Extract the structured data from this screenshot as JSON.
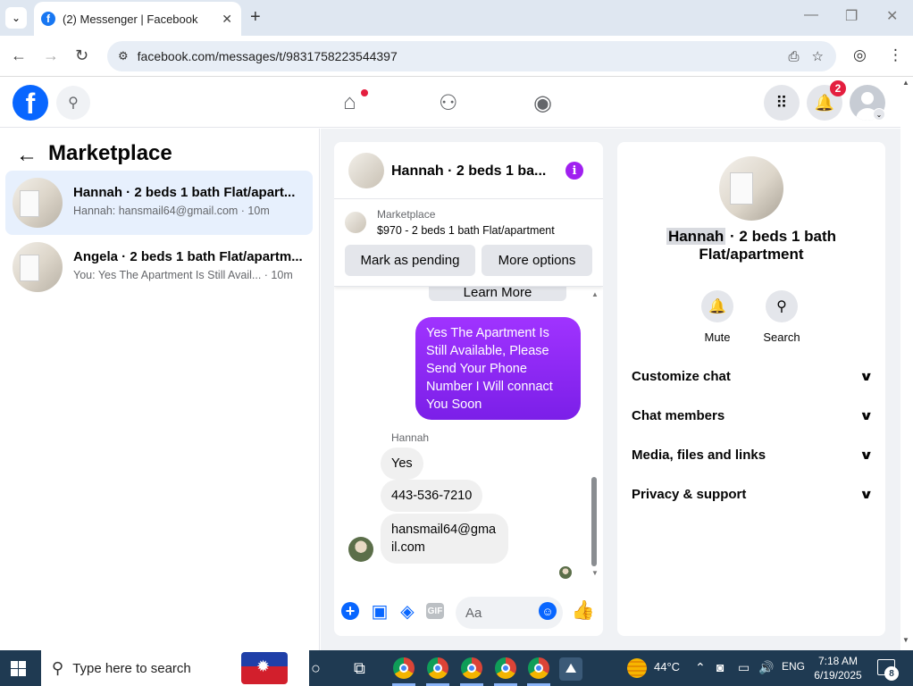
{
  "browser": {
    "tab_title": "(2) Messenger | Facebook",
    "url": "facebook.com/messages/t/9831758223544397",
    "new_tab_symbol": "+",
    "close_symbol": "✕"
  },
  "fb_header": {
    "logo_letter": "f",
    "notifications_count": "2",
    "accent": "#0866ff"
  },
  "left_panel": {
    "title": "Marketplace",
    "conversations": [
      {
        "name": "Hannah · 2 beds 1 bath Flat/apart...",
        "preview": "Hannah: hansmail64@gmail.com · 10m",
        "active": true
      },
      {
        "name": "Angela · 2 beds 1 bath Flat/apartm...",
        "preview": "You: Yes The Apartment Is Still Avail... · 10m",
        "active": false
      }
    ]
  },
  "chat": {
    "title": "Hannah · 2 beds 1 ba...",
    "marketplace_label": "Marketplace",
    "listing": "$970 - 2 beds 1 bath Flat/apartment",
    "mark_pending": "Mark as pending",
    "more_options": "More options",
    "learn_more": "Learn More",
    "outgoing_message": "Yes The Apartment Is Still Available, Please Send Your Phone Number I Will connact You Soon",
    "sender_name": "Hannah",
    "incoming": [
      "Yes",
      "443-536-7210",
      "hansmail64@gmail.com"
    ],
    "composer_placeholder": "Aa",
    "gif_label": "GIF",
    "outgoing_color": "#8a2be2"
  },
  "right_panel": {
    "name_highlight": "Hannah",
    "name_rest": " · 2 beds 1 bath Flat/apartment",
    "actions": [
      {
        "label": "Mute",
        "icon": "bell-icon"
      },
      {
        "label": "Search",
        "icon": "search-icon"
      }
    ],
    "sections": [
      "Customize chat",
      "Chat members",
      "Media, files and links",
      "Privacy & support"
    ]
  },
  "taskbar": {
    "search_placeholder": "Type here to search",
    "temperature": "44°C",
    "language": "ENG",
    "time": "7:18 AM",
    "date": "6/19/2025",
    "notification_count": "8"
  }
}
